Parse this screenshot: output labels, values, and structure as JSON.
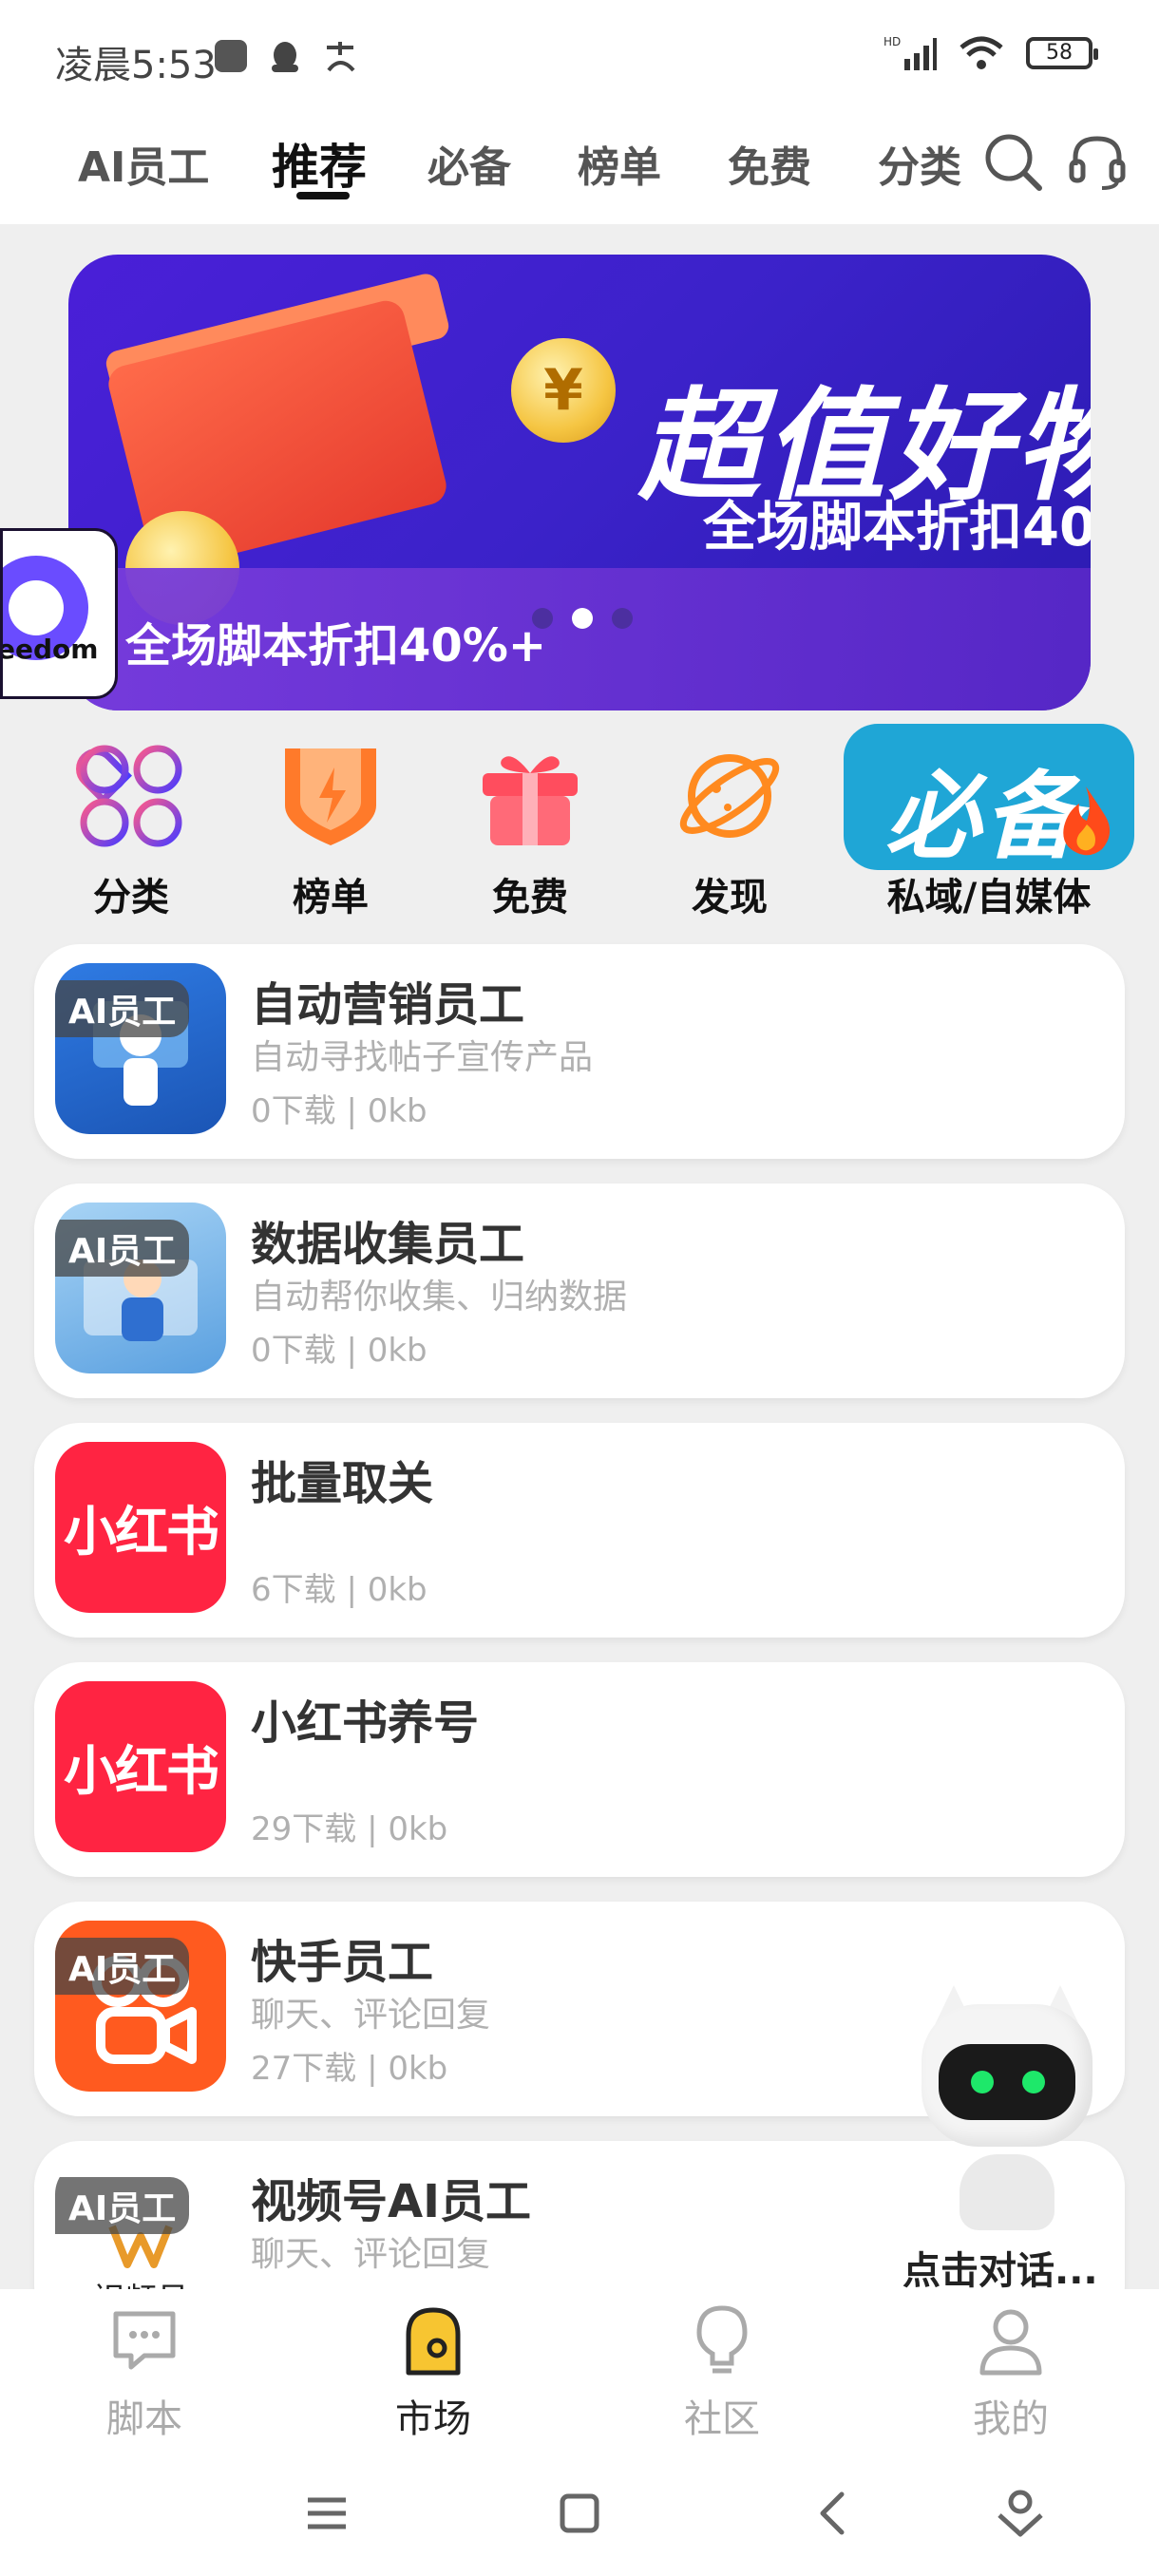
{
  "status_bar": {
    "time": "凌晨5:53",
    "battery": "58",
    "network": "HD"
  },
  "top_tabs": [
    {
      "label": "AI员工"
    },
    {
      "label": "推荐"
    },
    {
      "label": "必备"
    },
    {
      "label": "榜单"
    },
    {
      "label": "免费"
    },
    {
      "label": "分类"
    }
  ],
  "banner": {
    "title": "超值好物",
    "subtitle": "全场脚本折扣40",
    "caption": "全场脚本折扣40%+",
    "coin_text": "¥",
    "floating_logo_text": "eedom"
  },
  "categories": [
    {
      "label": "分类"
    },
    {
      "label": "榜单"
    },
    {
      "label": "免费"
    },
    {
      "label": "发现"
    }
  ],
  "bibei_card": {
    "text": "必备",
    "label": "私域/自媒体"
  },
  "list": [
    {
      "badge": "AI员工",
      "title": "自动营销员工",
      "desc": "自动寻找帖子宣传产品",
      "meta": "0下载 | 0kb"
    },
    {
      "badge": "AI员工",
      "title": "数据收集员工",
      "desc": "自动帮你收集、归纳数据",
      "meta": "0下载 | 0kb"
    },
    {
      "badge": "",
      "thumb_text": "小红书",
      "title": "批量取关",
      "desc": "",
      "meta": "6下载 | 0kb"
    },
    {
      "badge": "",
      "thumb_text": "小红书",
      "title": "小红书养号",
      "desc": "",
      "meta": "29下载 | 0kb"
    },
    {
      "badge": "AI员工",
      "title": "快手员工",
      "desc": "聊天、评论回复",
      "meta": "27下载 | 0kb"
    },
    {
      "badge": "AI员工",
      "thumb_text": "视频号",
      "title": "视频号AI员工",
      "desc": "聊天、评论回复",
      "meta": ""
    }
  ],
  "robot": {
    "label": "点击对话..."
  },
  "bottom_nav": [
    {
      "label": "脚本"
    },
    {
      "label": "市场"
    },
    {
      "label": "社区"
    },
    {
      "label": "我的"
    }
  ],
  "colors": {
    "accent_red": "#ff2442",
    "banner_purple": "#3b22c9",
    "bibei_blue": "#1fa6d6"
  }
}
